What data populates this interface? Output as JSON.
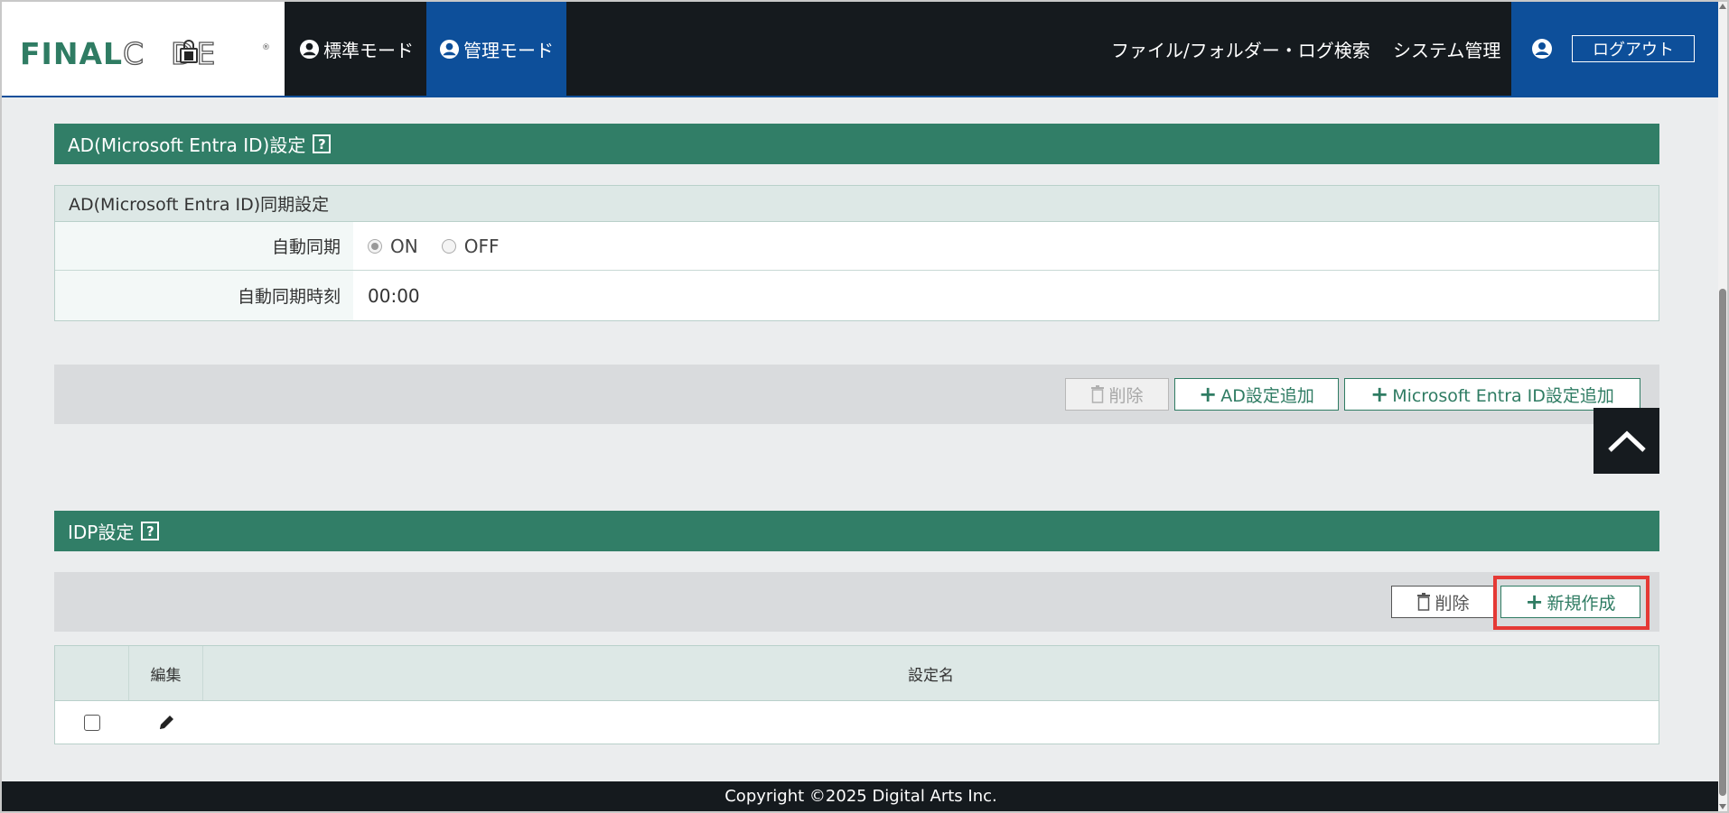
{
  "header": {
    "logo": "FINALCODE",
    "modes": [
      {
        "label": "標準モード"
      },
      {
        "label": "管理モード"
      }
    ],
    "nav": {
      "search": "ファイル/フォルダー・ログ検索",
      "system": "システム管理"
    },
    "logout": "ログアウト"
  },
  "ad_section": {
    "title": "AD(Microsoft Entra ID)設定",
    "help": "?",
    "sync": {
      "title": "AD(Microsoft Entra ID)同期設定",
      "auto_sync_label": "自動同期",
      "on": "ON",
      "off": "OFF",
      "selected": "ON",
      "time_label": "自動同期時刻",
      "time_value": "00:00"
    },
    "toolbar": {
      "delete": "削除",
      "add_ad": "AD設定追加",
      "add_entra": "Microsoft Entra ID設定追加"
    }
  },
  "idp_section": {
    "title": "IDP設定",
    "help": "?",
    "toolbar": {
      "delete": "削除",
      "new": "新規作成"
    },
    "table": {
      "columns": [
        "",
        "編集",
        "設定名"
      ],
      "rows": [
        {
          "name": ""
        }
      ]
    }
  },
  "footer": {
    "copyright": "Copyright ©2025 Digital Arts Inc."
  },
  "colors": {
    "brand_green": "#317e67",
    "header_dark": "#151a1e",
    "admin_blue": "#0d4f9a",
    "highlight_red": "#e53935"
  }
}
